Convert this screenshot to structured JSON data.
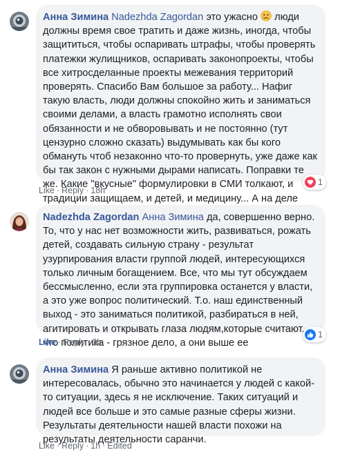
{
  "comments": [
    {
      "author": "Анна Зимина",
      "mention": "Nadezhda Zagordan",
      "text_before_emoji": "это ужасно",
      "emoji": "sad-face",
      "text_after_emoji": "люди должны время свое тратить и даже жизнь, иногда, чтобы защититься, чтобы оспаривать штрафы, чтобы проверять платежки жулищников, оспаривать законопроекты, чтобы все хитросделанные проекты межевания территорий проверять. Спасибо Вам большое за работу... Нафиг такую власть, люди должны спокойно жить и заниматься своими делами, а власть грамотно исполнять свои обязанности и не обворовывать и не постоянно (тут цензурно сложно сказать) выдумывать как бы кого обмануть чтоб незаконно что-то провернуть, уже даже как бы так закон с нужными дырами написать. Поправки те же. Какие \"вкусные\" формулировки в СМИ толкают, и традиции защищаем, и детей, и медицину... А на деле если вчитаться там такая жесть.....",
      "like_label": "Like",
      "reply_label": "Reply",
      "time": "18h",
      "edited": "",
      "reaction_icon": "heart-reaction-icon",
      "reaction_count": "1",
      "liked_by_viewer": false
    },
    {
      "author": "Nadezhda Zagordan",
      "mention": "Анна Зимина",
      "text": "да, совершенно верно. То, что у нас нет возможности жить, развиваться, рожать детей, создавать сильную страну - результат узурпирования власти группой людей, интересующихся только личным богащением. Все, что мы тут обсуждаем бессмысленно, если эта группировка останется у власти, а это уже вопрос политический. Т.о. наш единственный выход - это заниматься политикой, разбираться в ней, агитировать и открывать глаза людям,которые считают, что политика - грязное дело, а они выше ее",
      "like_label": "Like",
      "reply_label": "Reply",
      "time": "3h",
      "edited": "",
      "reaction_icon": "like-reaction-icon",
      "reaction_count": "1",
      "liked_by_viewer": true
    },
    {
      "author": "Анна Зимина",
      "mention": "",
      "text": "Я раньше активно политикой не интересовалась, обычно это начинается у людей с какой-то ситуации, здесь я не исключение. Таких ситуаций и людей все больше и это самые разные сферы жизни. Результаты деятельности нашей власти похожи на результаты деятельности саранчи.",
      "like_label": "Like",
      "reply_label": "Reply",
      "time": "1h",
      "edited": "Edited",
      "reaction_icon": "",
      "reaction_count": "",
      "liked_by_viewer": false
    }
  ],
  "separator": "·",
  "colors": {
    "bubble": "#f2f3f5",
    "name_link": "#385898",
    "text": "#1c1e21",
    "meta": "#606770",
    "like_active": "#4267b2",
    "heart": "#f33e58",
    "like_blue": "#1877f2"
  }
}
